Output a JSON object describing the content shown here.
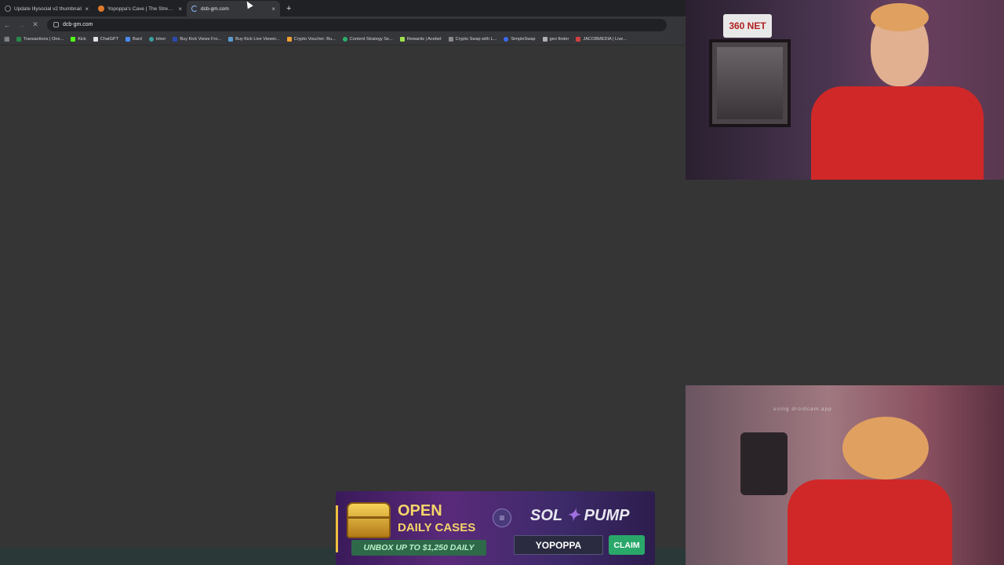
{
  "browser": {
    "tabs": [
      {
        "title": "Update Illysocial v2 thumbnail",
        "favicon_color": "#1f1f1f",
        "active": false
      },
      {
        "title": "Yopoppa's Cave | The Stream D",
        "favicon_color": "#e07a2a",
        "active": false
      },
      {
        "title": "dcb-gm.com",
        "favicon_color": "#4a6a9a",
        "active": true
      }
    ],
    "new_tab_glyph": "+",
    "close_glyph": "×",
    "address": "dcb-gm.com",
    "bookmarks": [
      {
        "label": "Transactions | One...",
        "color": "#2a8a4a"
      },
      {
        "label": "Kick",
        "color": "#53fc18"
      },
      {
        "label": "ChatGPT",
        "color": "#e0e0e0"
      },
      {
        "label": "Bard",
        "color": "#4a8af0"
      },
      {
        "label": "timer",
        "color": "#3aa0a0"
      },
      {
        "label": "Buy Kick Views Fro...",
        "color": "#2a4ab0"
      },
      {
        "label": "Buy Kick Live Viewer...",
        "color": "#5a9ad0"
      },
      {
        "label": "Crypto Voucher: Bu...",
        "color": "#f0a030"
      },
      {
        "label": "Content Strategy Se...",
        "color": "#2ab06a"
      },
      {
        "label": "Rewards | Acebet",
        "color": "#a0e050"
      },
      {
        "label": "Crypto Swap with L...",
        "color": "#8a8a8a"
      },
      {
        "label": "SimpleSwap",
        "color": "#3a6af0"
      },
      {
        "label": "geo finder",
        "color": "#b0b0b0"
      },
      {
        "label": "JACOBMEDIA | Live...",
        "color": "#d04040"
      }
    ]
  },
  "webcam": {
    "top_plate": "360 NET",
    "bottom_watermark": "using droidcam.app"
  },
  "ad": {
    "headline_1": "OPEN",
    "headline_2": "DAILY CASES",
    "sub": "UNBOX UP TO $1,250 DAILY",
    "brand_left": "SOL",
    "brand_right": "PUMP",
    "brand_icon": "rocket-icon",
    "code": "YOPOPPA",
    "cta": "CLAIM",
    "colors": {
      "gold": "#f4d56a",
      "green": "#2aa86a",
      "purple": "#5a2a7a"
    }
  }
}
